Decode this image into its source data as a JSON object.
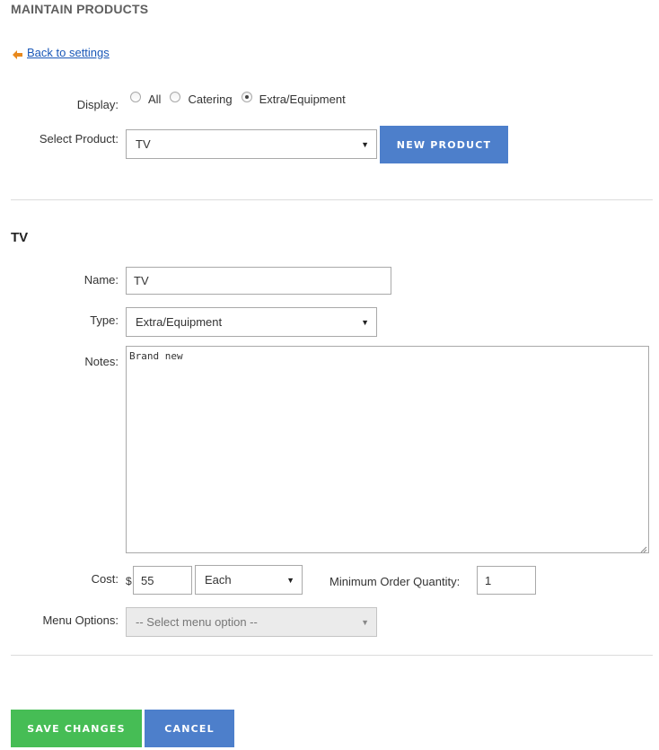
{
  "page": {
    "title": "MAINTAIN PRODUCTS",
    "back_link": "Back to settings"
  },
  "filter": {
    "display_label": "Display:",
    "options": [
      {
        "label": "All",
        "checked": false
      },
      {
        "label": "Catering",
        "checked": false
      },
      {
        "label": "Extra/Equipment",
        "checked": true
      }
    ],
    "select_product_label": "Select Product:",
    "selected_product": "TV",
    "new_product_button": "NEW PRODUCT"
  },
  "product": {
    "heading": "TV",
    "name_label": "Name:",
    "name_value": "TV",
    "type_label": "Type:",
    "type_value": "Extra/Equipment",
    "notes_label": "Notes:",
    "notes_value": "Brand new",
    "cost_label": "Cost:",
    "currency_symbol": "$",
    "cost_value": "55",
    "unit_value": "Each",
    "min_qty_label": "Minimum Order Quantity:",
    "min_qty_value": "1",
    "menu_options_label": "Menu Options:",
    "menu_options_value": "-- Select menu option --"
  },
  "actions": {
    "save_button": "SAVE CHANGES",
    "cancel_button": "CANCEL"
  },
  "colors": {
    "accent_blue": "#4d7fcb",
    "save_green": "#46bd55",
    "link_blue": "#1a58b8",
    "arrow_orange": "#e8891d"
  }
}
